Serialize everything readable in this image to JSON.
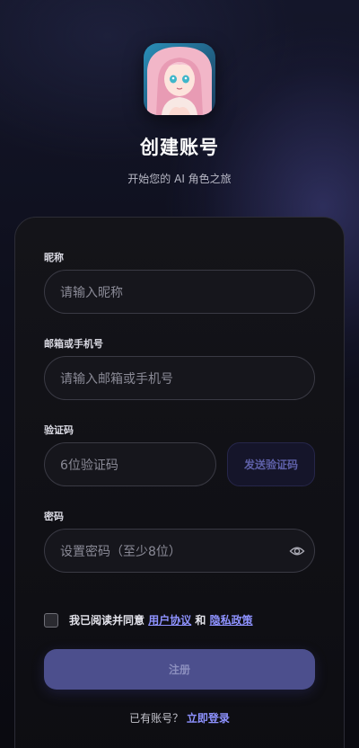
{
  "header": {
    "title": "创建账号",
    "subtitle": "开始您的 AI 角色之旅"
  },
  "form": {
    "nickname": {
      "label": "昵称",
      "placeholder": "请输入昵称"
    },
    "account": {
      "label": "邮箱或手机号",
      "placeholder": "请输入邮箱或手机号"
    },
    "code": {
      "label": "验证码",
      "placeholder": "6位验证码",
      "send_label": "发送验证码"
    },
    "password": {
      "label": "密码",
      "placeholder": "设置密码（至少8位）"
    },
    "agreement": {
      "prefix": "我已阅读并同意 ",
      "terms": "用户协议",
      "and": " 和 ",
      "privacy": "隐私政策",
      "checked": false
    },
    "submit_label": "注册",
    "login_prompt": "已有账号？ ",
    "login_link": "立即登录"
  },
  "colors": {
    "accent": "#8e92ff",
    "button": "#4c4f8d"
  },
  "icons": {
    "password_toggle": "eye-icon"
  }
}
